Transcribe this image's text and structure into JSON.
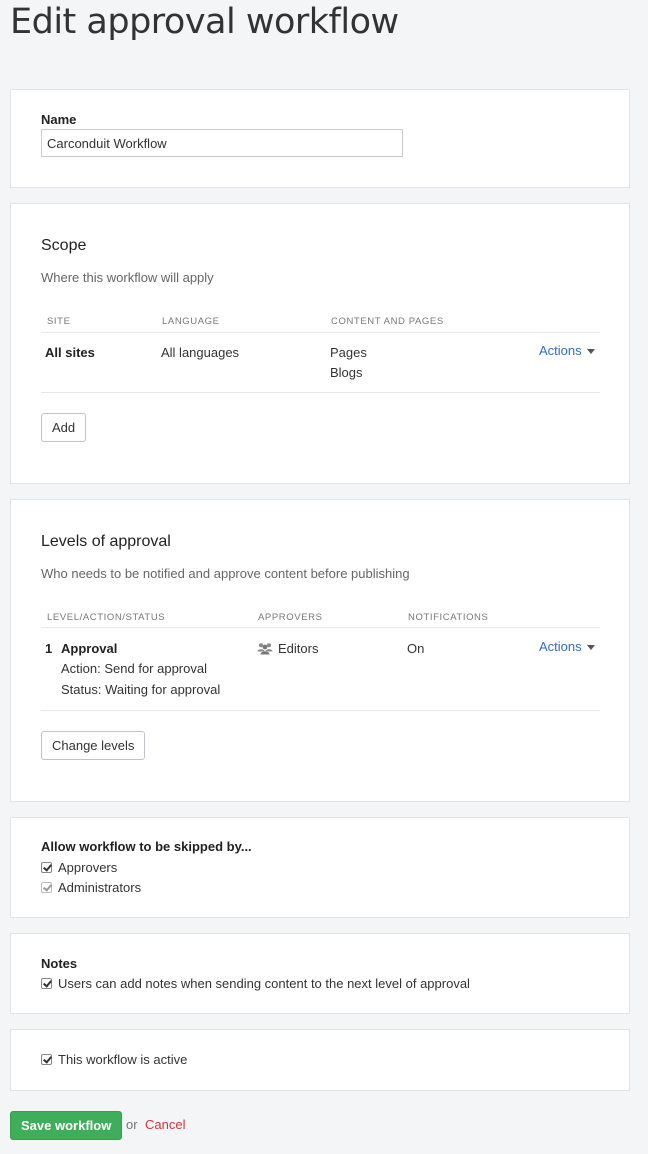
{
  "page": {
    "title": "Edit approval workflow"
  },
  "name_section": {
    "label": "Name",
    "value": "Carconduit Workflow"
  },
  "scope": {
    "heading": "Scope",
    "subheading": "Where this workflow will apply",
    "columns": [
      "SITE",
      "LANGUAGE",
      "CONTENT AND PAGES"
    ],
    "rows": [
      {
        "site": "All sites",
        "language": "All languages",
        "content": [
          "Pages",
          "Blogs"
        ],
        "actions_label": "Actions"
      }
    ],
    "add_label": "Add"
  },
  "levels": {
    "heading": "Levels of approval",
    "subheading": "Who needs to be notified and approve content before publishing",
    "columns": [
      "LEVEL/ACTION/STATUS",
      "APPROVERS",
      "NOTIFICATIONS"
    ],
    "rows": [
      {
        "number": "1",
        "name": "Approval",
        "action": "Action: Send for approval",
        "status": "Status: Waiting for approval",
        "approvers": "Editors",
        "approvers_icon": "users-icon",
        "notifications": "On",
        "actions_label": "Actions"
      }
    ],
    "change_label": "Change levels"
  },
  "skip": {
    "heading": "Allow workflow to be skipped by...",
    "options": [
      {
        "label": "Approvers",
        "checked": true,
        "disabled": false
      },
      {
        "label": "Administrators",
        "checked": true,
        "disabled": true
      }
    ]
  },
  "notes": {
    "heading": "Notes",
    "option": {
      "label": "Users can add notes when sending content to the next level of approval",
      "checked": true
    }
  },
  "active": {
    "label": "This workflow is active",
    "checked": true
  },
  "footer": {
    "save_label": "Save workflow",
    "or_text": "or",
    "cancel_label": "Cancel"
  },
  "colors": {
    "accent": "#2f6fbf",
    "save": "#3fae5a",
    "cancel": "#d9363e"
  }
}
